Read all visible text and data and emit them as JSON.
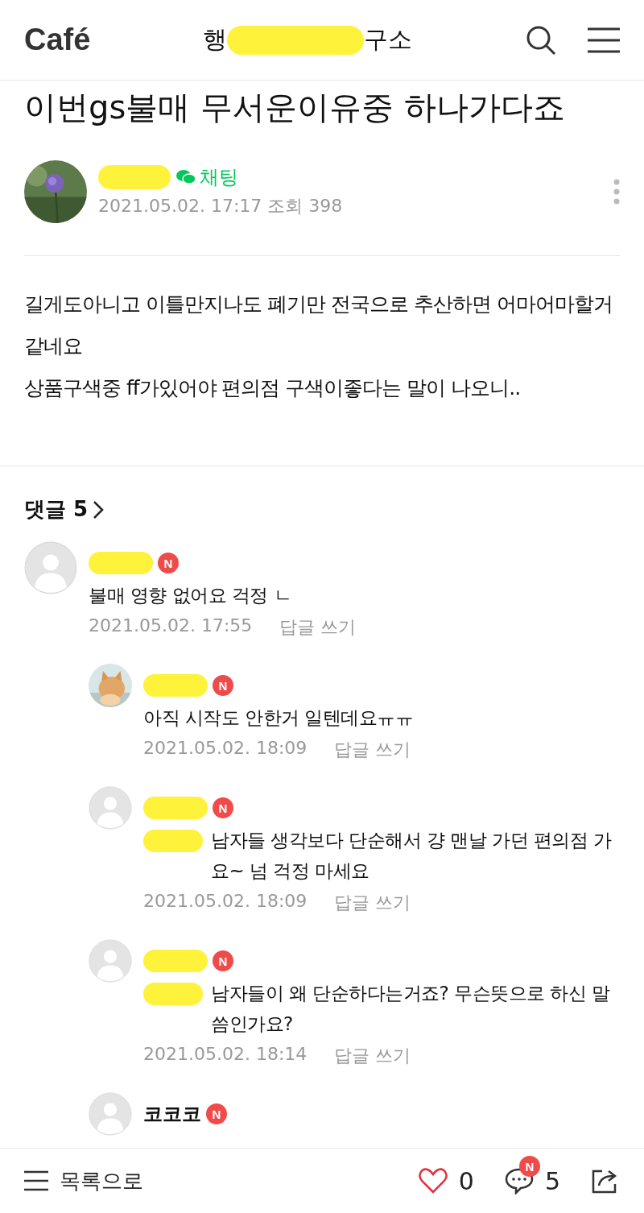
{
  "header": {
    "logo": "Café",
    "title_start": "행",
    "title_end": "구소"
  },
  "post": {
    "title": "이번gs불매 무서운이유중 하나가다죠",
    "author": {
      "chat_label": "채팅",
      "meta": "2021.05.02. 17:17  조회 398"
    },
    "body": [
      "길게도아니고 이틀만지나도 폐기만  전국으로 추산하면 어마어마할거같네요",
      "상품구색중  ff가있어야 편의점 구색이좋다는 말이 나오니.."
    ]
  },
  "comments_header": {
    "label": "댓글 5"
  },
  "comments": [
    {
      "reply": false,
      "avatar": {
        "kind": "default"
      },
      "badge": "N",
      "text": "불매 영향 없어요 걱정 ㄴ",
      "mention": false,
      "time": "2021.05.02. 17:55",
      "reply_label": "답글 쓰기"
    },
    {
      "reply": true,
      "badge": "N",
      "text": "아직 시작도 안한거 일텐데요ㅠㅠ",
      "mention": false,
      "time": "2021.05.02. 18:09",
      "reply_label": "답글 쓰기"
    },
    {
      "reply": true,
      "avatar": {
        "kind": "default"
      },
      "badge": "N",
      "text": "남자들 생각보다 단순해서 걍 맨날 가던 편의점 가요~ 넘 걱정 마세요",
      "mention": true,
      "time": "2021.05.02. 18:09",
      "reply_label": "답글 쓰기"
    },
    {
      "reply": true,
      "avatar": {
        "kind": "default"
      },
      "badge": "N",
      "text": "남자들이 왜 단순하다는거죠? 무슨뜻으로 하신 말씀인가요?",
      "mention": true,
      "time": "2021.05.02. 18:14",
      "reply_label": "답글 쓰기"
    },
    {
      "reply": true,
      "avatar": {
        "kind": "default"
      },
      "name": "코코코",
      "badge": "N"
    }
  ],
  "bottom_bar": {
    "list_label": "목록으로",
    "likes": "0",
    "comments": "5",
    "comments_badge": "N"
  }
}
